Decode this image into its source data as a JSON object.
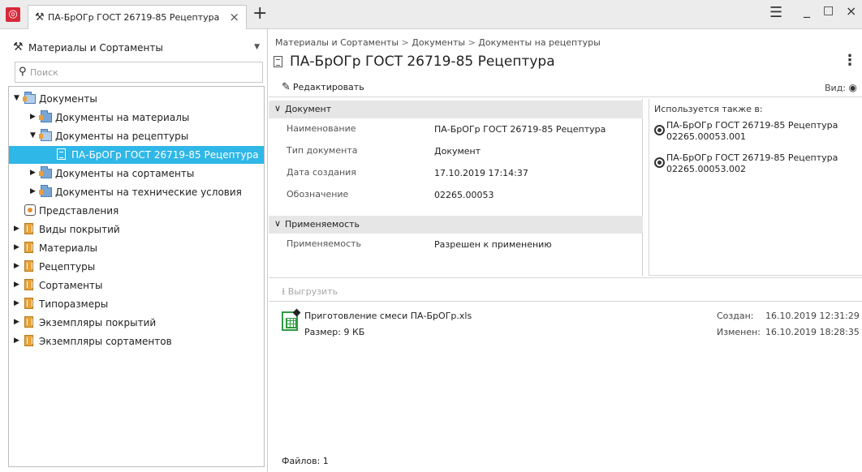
{
  "window": {
    "tab_title": "ПА-БрОГр ГОСТ 26719-85 Рецептура",
    "tab_close": "×",
    "new_tab": "+"
  },
  "left_panel": {
    "namespace": "Материалы и Сортаменты",
    "search_placeholder": "Поиск",
    "tree": [
      {
        "label": "Документы",
        "icon": "folder-open",
        "expanded": true,
        "level": 0
      },
      {
        "label": "Документы на материалы",
        "icon": "folder",
        "expanded": false,
        "level": 1
      },
      {
        "label": "Документы на рецептуры",
        "icon": "folder-open",
        "expanded": true,
        "level": 1
      },
      {
        "label": "ПА-БрОГр ГОСТ 26719-85 Рецептура",
        "icon": "document",
        "selected": true,
        "level": 2
      },
      {
        "label": "Документы на сортаменты",
        "icon": "folder",
        "expanded": false,
        "level": 1
      },
      {
        "label": "Документы на технические условия",
        "icon": "folder",
        "expanded": false,
        "level": 1
      },
      {
        "label": "Представления",
        "icon": "view",
        "level": 0
      },
      {
        "label": "Виды покрытий",
        "icon": "book",
        "expanded": false,
        "level": 0
      },
      {
        "label": "Материалы",
        "icon": "book",
        "expanded": false,
        "level": 0
      },
      {
        "label": "Рецептуры",
        "icon": "book",
        "expanded": false,
        "level": 0
      },
      {
        "label": "Сортаменты",
        "icon": "book",
        "expanded": false,
        "level": 0
      },
      {
        "label": "Типоразмеры",
        "icon": "book",
        "expanded": false,
        "level": 0
      },
      {
        "label": "Экземпляры покрытий",
        "icon": "book",
        "expanded": false,
        "level": 0
      },
      {
        "label": "Экземпляры сортаментов",
        "icon": "book",
        "expanded": false,
        "level": 0
      }
    ]
  },
  "breadcrumb": [
    "Материалы и Сортаменты",
    "Документы",
    "Документы на рецептуры"
  ],
  "breadcrumb_sep": ">",
  "page_title": "ПА-БрОГр ГОСТ 26719-85 Рецептура",
  "toolbar": {
    "edit_label": "Редактировать",
    "view_label": "Вид:"
  },
  "document_section": {
    "title": "Документ",
    "rows": [
      {
        "key": "Наименование",
        "value": "ПА-БрОГр ГОСТ 26719-85 Рецептура"
      },
      {
        "key": "Тип документа",
        "value": "Документ"
      },
      {
        "key": "Дата создания",
        "value": "17.10.2019 17:14:37"
      },
      {
        "key": "Обозначение",
        "value": "02265.00053"
      }
    ]
  },
  "applicability_section": {
    "title": "Применяемость",
    "rows": [
      {
        "key": "Применяемость",
        "value": "Разрешен к применению"
      }
    ]
  },
  "also_used": {
    "title": "Используется также в:",
    "items": [
      {
        "name": "ПА-БрОГр ГОСТ 26719-85 Рецептура",
        "code": "02265.00053.001"
      },
      {
        "name": "ПА-БрОГр ГОСТ 26719-85 Рецептура",
        "code": "02265.00053.002"
      }
    ]
  },
  "files": {
    "download_label": "Выгрузить",
    "file": {
      "name": "Приготовление смеси ПА-БрОГр.xls",
      "size": "Размер: 9 КБ",
      "created_label": "Создан:",
      "created_value": "16.10.2019 12:31:29",
      "modified_label": "Изменен:",
      "modified_value": "16.10.2019 18:28:35"
    },
    "count_label": "Файлов: 1"
  }
}
